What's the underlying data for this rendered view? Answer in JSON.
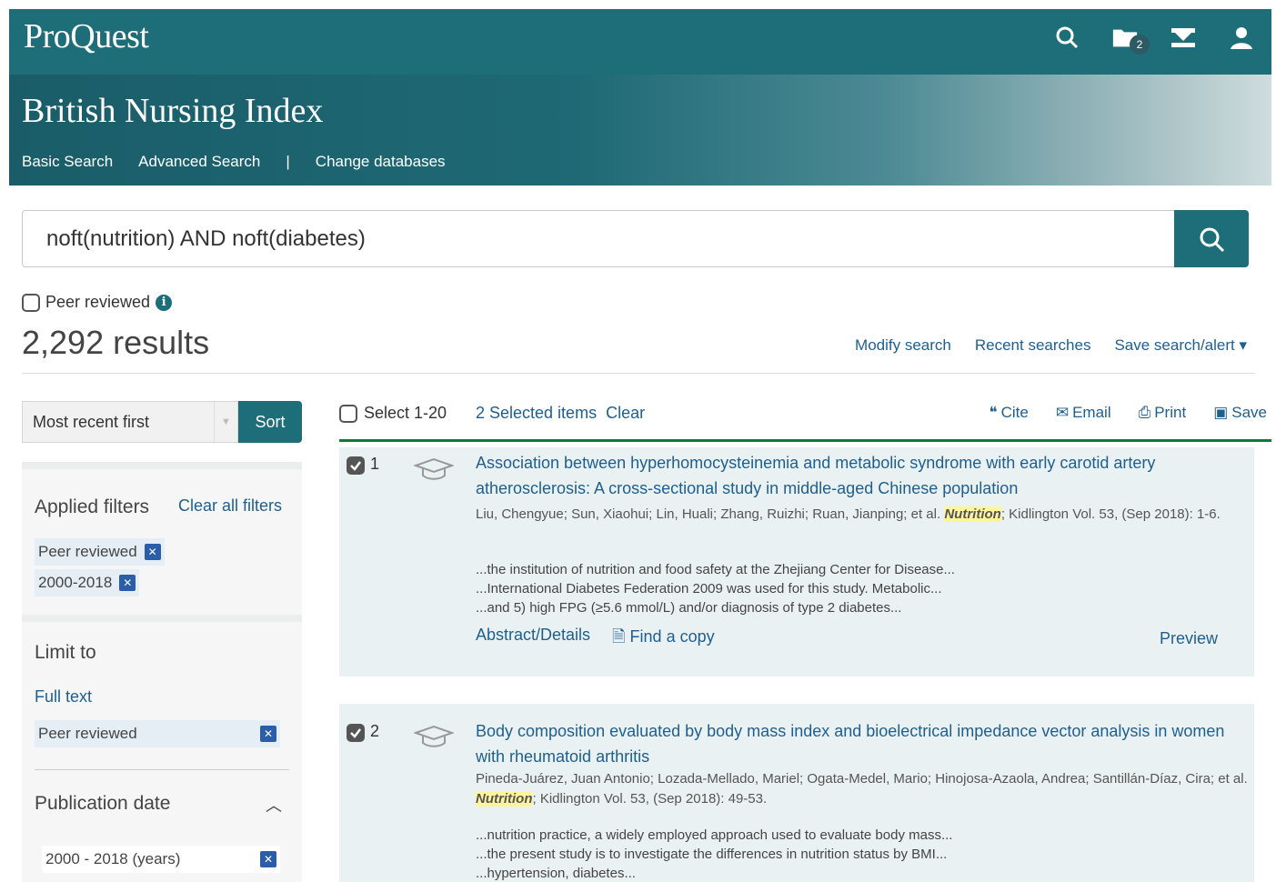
{
  "header": {
    "logo": "ProQuest",
    "folder_count": "2",
    "icons": [
      "search-icon",
      "folder-icon",
      "alert-icon",
      "user-icon"
    ],
    "brand_color": "#1e6e7a"
  },
  "database": {
    "title": "British Nursing Index",
    "nav": {
      "basic": "Basic Search",
      "advanced": "Advanced Search",
      "separator": "|",
      "change": "Change databases"
    }
  },
  "search": {
    "query": "noft(nutrition) AND noft(diabetes)"
  },
  "peer_reviewed_label": "Peer reviewed",
  "results": {
    "count": "2,292 results",
    "modify": "Modify search",
    "recent": "Recent searches",
    "save": "Save search/alert ▾"
  },
  "sort": {
    "selected": "Most recent first",
    "button": "Sort"
  },
  "sidebar": {
    "applied_title": "Applied filters",
    "clear_all": "Clear all filters",
    "applied": [
      "Peer reviewed",
      "2000-2018"
    ],
    "limit_title": "Limit to",
    "full_text": "Full text",
    "peer_reviewed": "Peer reviewed",
    "pubdate_title": "Publication date",
    "date_range": "2000 - 2018 (years)"
  },
  "toolbar": {
    "select_label": "Select 1-20",
    "selected_items": "2 Selected items",
    "clear": "Clear",
    "cite": "Cite",
    "email": "Email",
    "print": "Print",
    "save": "Save"
  },
  "records": [
    {
      "number": "1",
      "title": "Association between hyperhomocysteinemia and metabolic syndrome with early carotid artery atherosclerosis: A cross-sectional study in middle-aged Chinese population",
      "authors_pre": "Liu, Chengyue; Sun, Xiaohui; Lin, Huali; Zhang, Ruizhi; Ruan, Jianping; et al. ",
      "journal": "Nutrition",
      "authors_post": "; Kidlington Vol. 53, (Sep 2018): 1-6.",
      "snippets": [
        "...the institution of nutrition and food safety at the Zhejiang Center for Disease...",
        "...International Diabetes Federation 2009 was used for this study. Metabolic...",
        "...and 5) high FPG (≥5.6 mmol/L) and/or diagnosis of type 2 diabetes..."
      ],
      "abstract": "Abstract/Details",
      "find_copy": "Find a copy",
      "preview": "Preview"
    },
    {
      "number": "2",
      "title": "Body composition evaluated by body mass index and bioelectrical impedance vector analysis in women with rheumatoid arthritis",
      "authors_pre": "Pineda-Juárez, Juan Antonio; Lozada-Mellado, Mariel; Ogata-Medel, Mario; Hinojosa-Azaola, Andrea; Santillán-Díaz, Cira; et al. ",
      "journal": "Nutrition",
      "authors_post": "; Kidlington Vol. 53, (Sep 2018): 49-53.",
      "snippets": [
        "...nutrition practice, a widely employed approach used to evaluate body mass...",
        "...the present study is to investigate the differences in nutrition status by BMI...",
        "...hypertension, diabetes..."
      ]
    }
  ]
}
